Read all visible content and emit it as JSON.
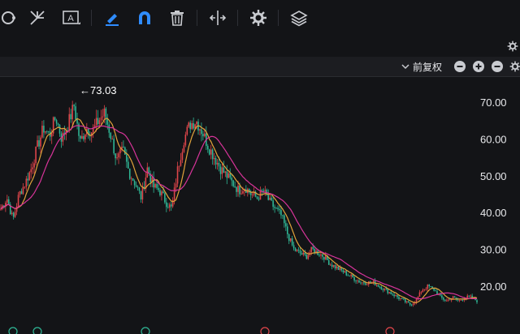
{
  "header": {
    "adjust_label": "前复权"
  },
  "toolbar": {
    "tools": [
      {
        "name": "circle-icon"
      },
      {
        "name": "fork-icon"
      },
      {
        "name": "text-icon",
        "label": "A"
      },
      {
        "name": "pen-icon"
      },
      {
        "name": "magnet-icon"
      },
      {
        "name": "trash-icon"
      },
      {
        "name": "resize-icon"
      },
      {
        "name": "gear-icon"
      },
      {
        "name": "layers-icon"
      }
    ]
  },
  "colors": {
    "up": "#e0454a",
    "down": "#2fb796",
    "ma_short": "#e2a43b",
    "ma_long": "#d8349a",
    "accent": "#2f8cff"
  },
  "chart_data": {
    "type": "candlestick",
    "y_ticks": [
      "70.00",
      "60.00",
      "50.00",
      "40.00",
      "30.00",
      "20.00"
    ],
    "ylim": [
      13,
      78
    ],
    "max_label": "←73.03",
    "max_value": 73.03,
    "grid": false,
    "close_series": [
      41,
      44,
      38,
      45,
      48,
      52,
      58,
      63,
      61,
      66,
      60,
      64,
      69,
      59,
      63,
      62,
      65,
      67,
      61,
      54,
      57,
      51,
      48,
      44,
      52,
      47,
      46,
      43,
      41,
      52,
      60,
      64,
      65,
      62,
      58,
      55,
      52,
      50,
      48,
      46,
      47,
      45,
      44,
      46,
      43,
      41,
      39,
      34,
      30,
      29,
      28,
      30,
      29,
      28,
      26,
      25,
      24,
      23,
      22,
      21,
      21,
      21,
      20,
      19,
      18,
      17,
      16,
      15,
      16,
      19,
      20,
      19,
      17,
      16,
      17,
      16,
      17,
      17,
      16
    ]
  }
}
